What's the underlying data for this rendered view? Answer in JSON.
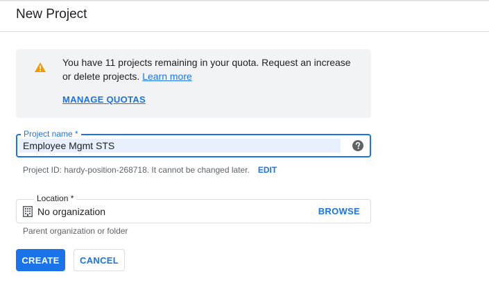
{
  "header": {
    "title": "New Project"
  },
  "quota": {
    "message": "You have 11 projects remaining in your quota. Request an increase or delete projects.",
    "learn_more": "Learn more",
    "manage_quotas": "MANAGE QUOTAS",
    "icon": "warning-icon",
    "icon_color": "#f29900"
  },
  "project_name": {
    "label": "Project name *",
    "value": "Employee Mgmt STS",
    "help_icon": "help-icon"
  },
  "project_id": {
    "text": "Project ID: hardy-position-268718. It cannot be changed later.",
    "edit": "EDIT"
  },
  "location": {
    "label": "Location *",
    "value": "No organization",
    "icon": "building-icon",
    "browse": "BROWSE",
    "hint": "Parent organization or folder"
  },
  "actions": {
    "create": "CREATE",
    "cancel": "CANCEL"
  },
  "colors": {
    "accent": "#1a73e8",
    "quota_background": "#f1f3f4",
    "input_highlight": "#e8f0fe"
  }
}
